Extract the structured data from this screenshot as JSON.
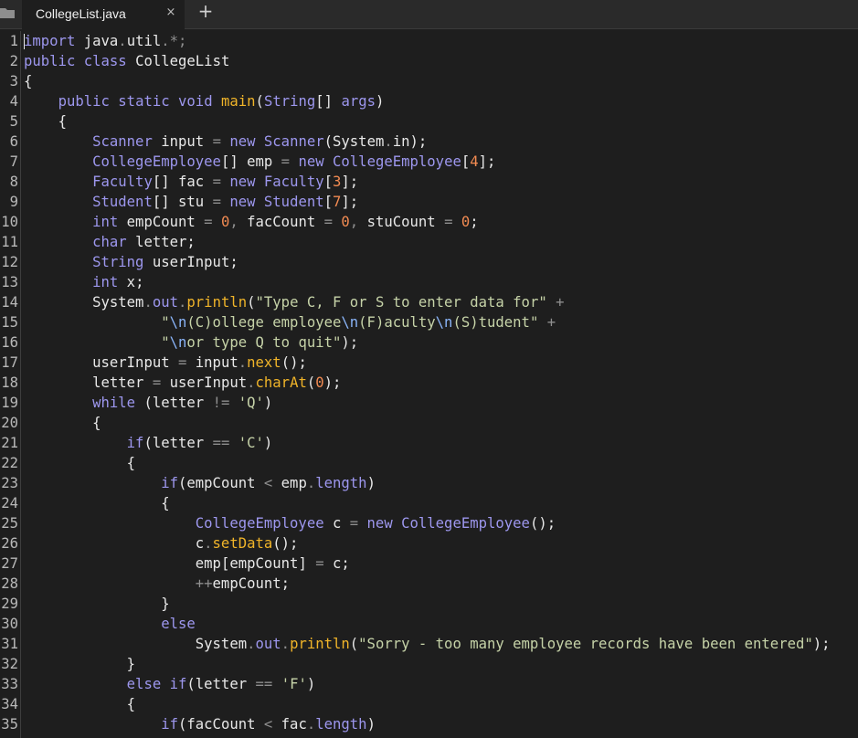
{
  "tab": {
    "title": "CollegeList.java",
    "close": "×",
    "new_tab": "+"
  },
  "code": [
    "import java.util.*;",
    "public class CollegeList",
    "{",
    "    public static void main(String[] args)",
    "    {",
    "        Scanner input = new Scanner(System.in);",
    "        CollegeEmployee[] emp = new CollegeEmployee[4];",
    "        Faculty[] fac = new Faculty[3];",
    "        Student[] stu = new Student[7];",
    "        int empCount = 0, facCount = 0, stuCount = 0;",
    "        char letter;",
    "        String userInput;",
    "        int x;",
    "        System.out.println(\"Type C, F or S to enter data for\" +",
    "                \"\\n(C)ollege employee\\n(F)aculty\\n(S)tudent\" +",
    "                \"\\nor type Q to quit\");",
    "        userInput = input.next();",
    "        letter = userInput.charAt(0);",
    "        while (letter != 'Q')",
    "        {",
    "            if(letter == 'C')",
    "            {",
    "                if(empCount < emp.length)",
    "                {",
    "                    CollegeEmployee c = new CollegeEmployee();",
    "                    c.setData();",
    "                    emp[empCount] = c;",
    "                    ++empCount;",
    "                }",
    "                else",
    "                    System.out.println(\"Sorry - too many employee records have been entered\");",
    "            }",
    "            else if(letter == 'F')",
    "            {",
    "                if(facCount < fac.length)"
  ],
  "colors": {
    "keyword": "#9d97ee",
    "function": "#f0b429",
    "string": "#c6d3a8",
    "escape": "#8ab4f8",
    "number": "#f28b52",
    "operator": "#8e8e8e",
    "default": "#e8e8e8"
  },
  "icons": {
    "folder": "folder-icon",
    "close": "close-icon",
    "add": "plus-icon"
  }
}
